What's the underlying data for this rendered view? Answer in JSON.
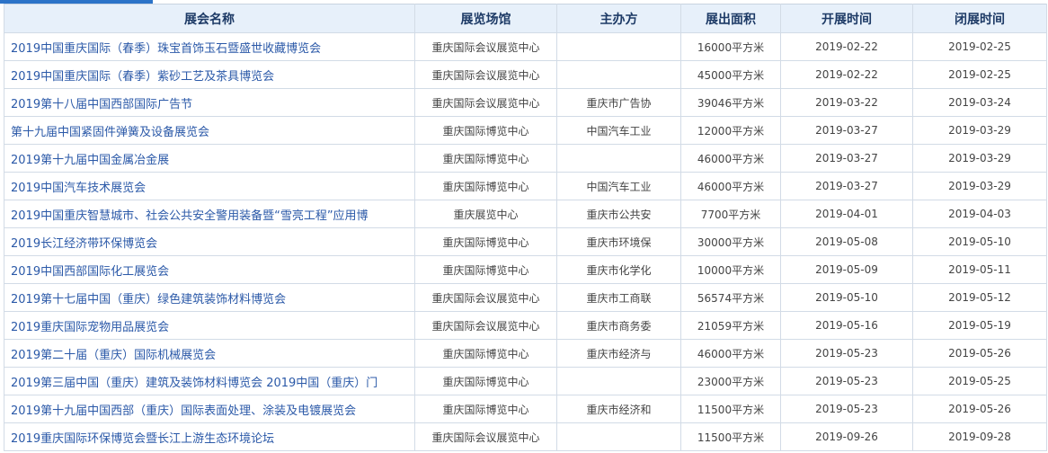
{
  "header": {
    "name": "展会名称",
    "venue": "展览场馆",
    "organizer": "主办方",
    "area": "展出面积",
    "start": "开展时间",
    "end": "闭展时间"
  },
  "rows": [
    {
      "name": "2019中国重庆国际（春季）珠宝首饰玉石暨盛世收藏博览会",
      "venue": "重庆国际会议展览中心",
      "organizer": "",
      "area": "16000平方米",
      "start": "2019-02-22",
      "end": "2019-02-25"
    },
    {
      "name": "2019中国重庆国际（春季）紫砂工艺及茶具博览会",
      "venue": "重庆国际会议展览中心",
      "organizer": "",
      "area": "45000平方米",
      "start": "2019-02-22",
      "end": "2019-02-25"
    },
    {
      "name": "2019第十八届中国西部国际广告节",
      "venue": "重庆国际会议展览中心",
      "organizer": "重庆市广告协",
      "area": "39046平方米",
      "start": "2019-03-22",
      "end": "2019-03-24"
    },
    {
      "name": "第十九届中国紧固件弹簧及设备展览会",
      "venue": "重庆国际博览中心",
      "organizer": "中国汽车工业",
      "area": "12000平方米",
      "start": "2019-03-27",
      "end": "2019-03-29"
    },
    {
      "name": "2019第十九届中国金属冶金展",
      "venue": "重庆国际博览中心",
      "organizer": "",
      "area": "46000平方米",
      "start": "2019-03-27",
      "end": "2019-03-29"
    },
    {
      "name": "2019中国汽车技术展览会",
      "venue": "重庆国际博览中心",
      "organizer": "中国汽车工业",
      "area": "46000平方米",
      "start": "2019-03-27",
      "end": "2019-03-29"
    },
    {
      "name": "2019中国重庆智慧城市、社会公共安全警用装备暨“雪亮工程”应用博",
      "venue": "重庆展览中心",
      "organizer": "重庆市公共安",
      "area": "7700平方米",
      "start": "2019-04-01",
      "end": "2019-04-03"
    },
    {
      "name": "2019长江经济带环保博览会",
      "venue": "重庆国际博览中心",
      "organizer": "重庆市环境保",
      "area": "30000平方米",
      "start": "2019-05-08",
      "end": "2019-05-10"
    },
    {
      "name": "2019中国西部国际化工展览会",
      "venue": "重庆国际博览中心",
      "organizer": "重庆市化学化",
      "area": "10000平方米",
      "start": "2019-05-09",
      "end": "2019-05-11"
    },
    {
      "name": "2019第十七届中国（重庆）绿色建筑装饰材料博览会",
      "venue": "重庆国际会议展览中心",
      "organizer": "重庆市工商联",
      "area": "56574平方米",
      "start": "2019-05-10",
      "end": "2019-05-12"
    },
    {
      "name": "2019重庆国际宠物用品展览会",
      "venue": "重庆国际会议展览中心",
      "organizer": "重庆市商务委",
      "area": "21059平方米",
      "start": "2019-05-16",
      "end": "2019-05-19"
    },
    {
      "name": "2019第二十届（重庆）国际机械展览会",
      "venue": "重庆国际博览中心",
      "organizer": "重庆市经济与",
      "area": "46000平方米",
      "start": "2019-05-23",
      "end": "2019-05-26"
    },
    {
      "name": "2019第三届中国（重庆）建筑及装饰材料博览会 2019中国（重庆）门",
      "venue": "重庆国际博览中心",
      "organizer": "",
      "area": "23000平方米",
      "start": "2019-05-23",
      "end": "2019-05-25"
    },
    {
      "name": "2019第十九届中国西部（重庆）国际表面处理、涂装及电镀展览会",
      "venue": "重庆国际博览中心",
      "organizer": "重庆市经济和",
      "area": "11500平方米",
      "start": "2019-05-23",
      "end": "2019-05-26"
    },
    {
      "name": "2019重庆国际环保博览会暨长江上游生态环境论坛",
      "venue": "重庆国际会议展览中心",
      "organizer": "",
      "area": "11500平方米",
      "start": "2019-09-26",
      "end": "2019-09-28"
    }
  ]
}
